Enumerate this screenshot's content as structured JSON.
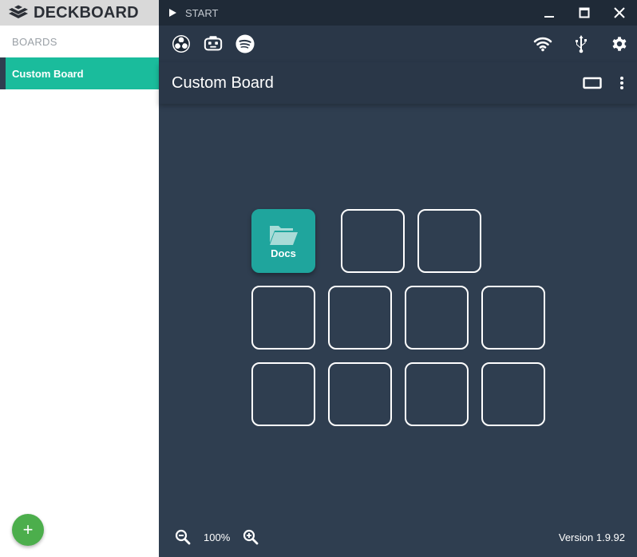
{
  "app": {
    "brand": "DECKBOARD",
    "start_label": "START"
  },
  "sidebar": {
    "section_label": "BOARDS",
    "boards": [
      {
        "label": "Custom Board",
        "selected": true
      }
    ],
    "add_button": "+"
  },
  "toolbar": {
    "left_icons": [
      "obs-icon",
      "streamlabs-icon",
      "spotify-icon"
    ],
    "right_icons": [
      "wifi-icon",
      "usb-icon",
      "gear-icon"
    ]
  },
  "board": {
    "title": "Custom Board",
    "header_icons": [
      "screen-icon",
      "more-vertical-icon"
    ],
    "keys": [
      {
        "label": "Docs",
        "icon": "folder-icon",
        "filled": true
      },
      {
        "label": "",
        "filled": false
      },
      {
        "label": "",
        "filled": false
      },
      {
        "label": "",
        "filled": false
      },
      {
        "label": "",
        "filled": false
      },
      {
        "label": "",
        "filled": false
      },
      {
        "label": "",
        "filled": false
      },
      {
        "label": "",
        "filled": false
      },
      {
        "label": "",
        "filled": false
      },
      {
        "label": "",
        "filled": false
      },
      {
        "label": "",
        "filled": false
      }
    ]
  },
  "footer": {
    "zoom": "100%",
    "version": "Version 1.9.92"
  },
  "colors": {
    "accent": "#1abc9c",
    "key_filled": "#1fa59d",
    "background": "#2f3e50",
    "fab": "#4cae4c"
  }
}
